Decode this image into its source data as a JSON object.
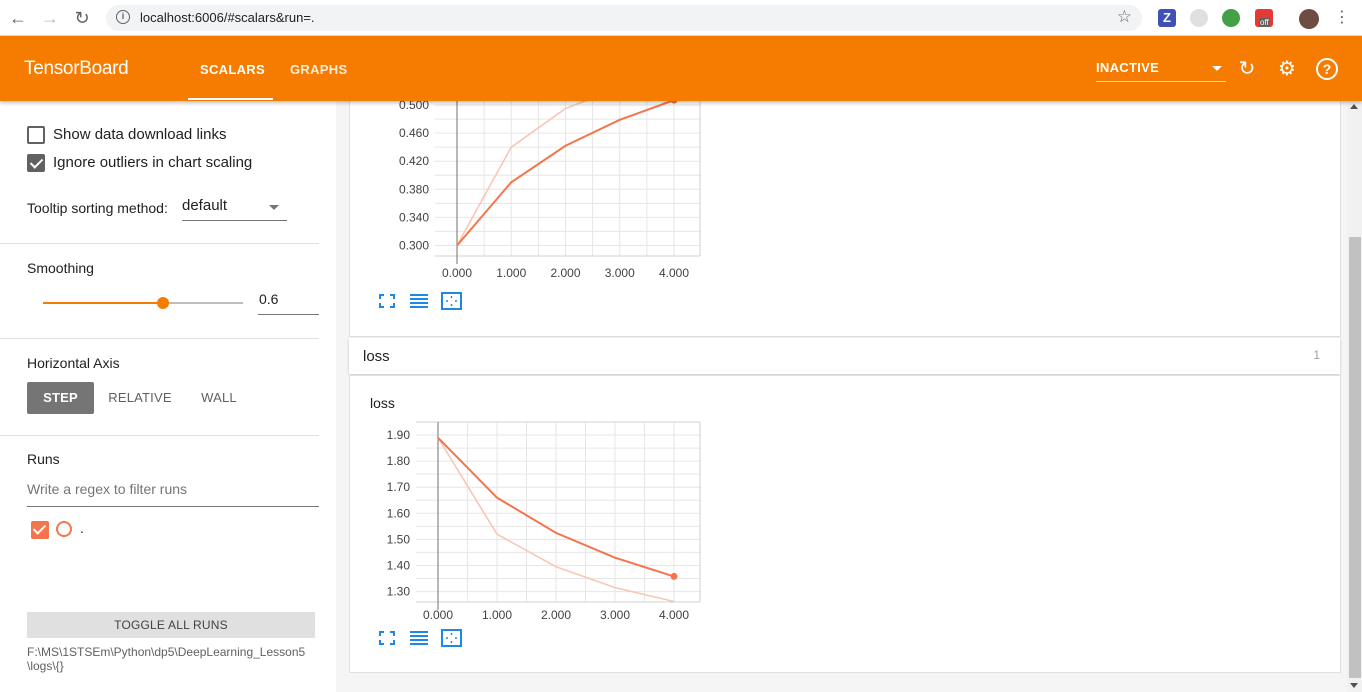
{
  "browser": {
    "url": "localhost:6006/#scalars&run=.",
    "badge_text": "off"
  },
  "header": {
    "title": "TensorBoard",
    "tabs": [
      {
        "label": "SCALARS",
        "active": true
      },
      {
        "label": "GRAPHS",
        "active": false
      }
    ],
    "status_select": "INACTIVE",
    "accent_color": "#f57c00"
  },
  "sidebar": {
    "show_download_links": {
      "label": "Show data download links",
      "checked": false
    },
    "ignore_outliers": {
      "label": "Ignore outliers in chart scaling",
      "checked": true
    },
    "tooltip_sorting": {
      "label": "Tooltip sorting method:",
      "value": "default"
    },
    "smoothing": {
      "label": "Smoothing",
      "value": "0.6",
      "fraction": 0.6
    },
    "horizontal_axis": {
      "label": "Horizontal Axis",
      "options": [
        "STEP",
        "RELATIVE",
        "WALL"
      ],
      "selected": "STEP"
    },
    "runs": {
      "label": "Runs",
      "filter_placeholder": "Write a regex to filter runs",
      "items": [
        {
          "name": ".",
          "checked": true,
          "color": "#f4754c"
        }
      ],
      "toggle_all_label": "TOGGLE ALL RUNS",
      "logdir": "F:\\MS\\1STSEm\\Python\\dp5\\DeepLearning_Lesson5\\logs\\{}"
    }
  },
  "main": {
    "loss_group": {
      "name": "loss",
      "count": "1"
    }
  },
  "chart_data": [
    {
      "type": "line",
      "title": "",
      "x": [
        0,
        1,
        2,
        3,
        4
      ],
      "x_tick_labels": [
        "0.000",
        "1.000",
        "2.000",
        "3.000",
        "4.000"
      ],
      "y_tick_labels": [
        "0.300",
        "0.340",
        "0.380",
        "0.420",
        "0.460",
        "0.500"
      ],
      "ylim": [
        0.285,
        0.52
      ],
      "series": [
        {
          "role": "smoothed",
          "values": [
            0.3,
            0.39,
            0.442,
            0.479,
            0.507
          ],
          "color": "#f4754c"
        },
        {
          "role": "raw",
          "values": [
            0.3,
            0.44,
            0.495,
            0.525,
            0.548
          ],
          "color": "#f9c6b5"
        }
      ],
      "grid": true
    },
    {
      "type": "line",
      "title": "loss",
      "x": [
        0,
        1,
        2,
        3,
        4
      ],
      "x_tick_labels": [
        "0.000",
        "1.000",
        "2.000",
        "3.000",
        "4.000"
      ],
      "y_tick_labels": [
        "1.30",
        "1.40",
        "1.50",
        "1.60",
        "1.70",
        "1.80",
        "1.90"
      ],
      "ylim": [
        1.26,
        1.95
      ],
      "series": [
        {
          "role": "smoothed",
          "values": [
            1.89,
            1.66,
            1.525,
            1.43,
            1.358
          ],
          "color": "#f4754c"
        },
        {
          "role": "raw",
          "values": [
            1.89,
            1.52,
            1.395,
            1.315,
            1.262
          ],
          "color": "#f9c6b5"
        }
      ],
      "grid": true
    }
  ]
}
